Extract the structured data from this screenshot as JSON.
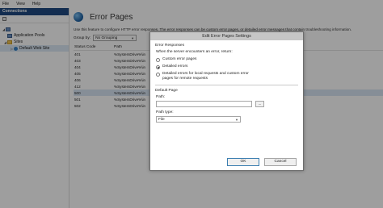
{
  "menu": [
    "File",
    "View",
    "Help"
  ],
  "connections": {
    "title": "Connections",
    "tree": [
      {
        "label": "",
        "icon": "server-icon"
      },
      {
        "label": "Application Pools",
        "icon": "app-pool-icon"
      },
      {
        "label": "Sites",
        "icon": "folder-icon"
      },
      {
        "label": "Default Web Site",
        "icon": "globe-icon"
      }
    ]
  },
  "feature": {
    "title": "Error Pages",
    "description": "Use this feature to configure HTTP error responses. The error responses can be custom error pages, or detailed error messages that contain troubleshooting information.",
    "group_by_label": "Group by:",
    "group_by_value": "No Grouping"
  },
  "list": {
    "columns": [
      "Status Code",
      "Path"
    ],
    "rows": [
      {
        "code": "401",
        "path": "%SystemDrive%\\in"
      },
      {
        "code": "403",
        "path": "%SystemDrive%\\in"
      },
      {
        "code": "404",
        "path": "%SystemDrive%\\in"
      },
      {
        "code": "405",
        "path": "%SystemDrive%\\in"
      },
      {
        "code": "406",
        "path": "%SystemDrive%\\in"
      },
      {
        "code": "412",
        "path": "%SystemDrive%\\in"
      },
      {
        "code": "500",
        "path": "%SystemDrive%\\in"
      },
      {
        "code": "501",
        "path": "%SystemDrive%\\in"
      },
      {
        "code": "502",
        "path": "%SystemDrive%\\in"
      }
    ],
    "selected_index": 6
  },
  "dialog": {
    "title": "Edit Error Pages Settings",
    "error_responses_label": "Error Responses",
    "question": "When the server encounters an error, return:",
    "options": [
      "Custom error pages",
      "Detailed errors",
      "Detailed errors for local requests and custom error pages for remote requests"
    ],
    "selected_option": 1,
    "default_page_label": "Default Page",
    "path_label": "Path:",
    "path_value": "",
    "browse_label": "...",
    "path_type_label": "Path type:",
    "path_type_value": "File",
    "ok_label": "OK",
    "cancel_label": "Cancel"
  }
}
